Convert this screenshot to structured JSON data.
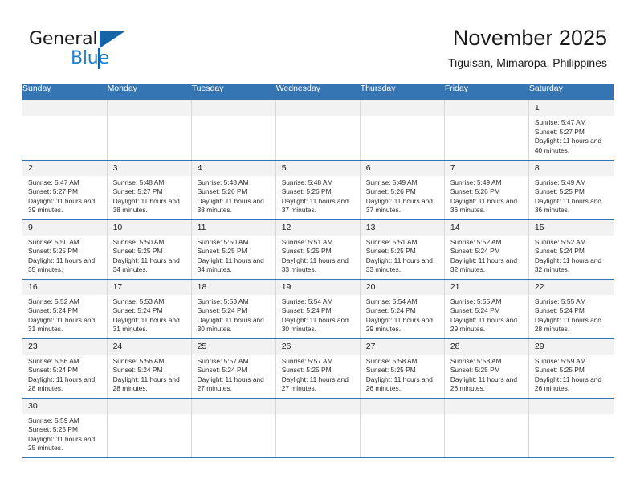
{
  "brand": {
    "name_part1": "General",
    "name_part2": "Blue"
  },
  "header": {
    "title": "November 2025",
    "subtitle": "Tiguisan, Mimaropa, Philippines"
  },
  "colors": {
    "header_blue": "#3575b4",
    "brand_blue": "#2280c8",
    "brand_dark_blue": "#1565a8",
    "daynum_bg": "#f2f2f2",
    "cell_border": "#d8d8d8"
  },
  "weekdays": [
    "Sunday",
    "Monday",
    "Tuesday",
    "Wednesday",
    "Thursday",
    "Friday",
    "Saturday"
  ],
  "weeks": [
    [
      {
        "day": "",
        "empty": true,
        "sunrise": "",
        "sunset": "",
        "daylight": ""
      },
      {
        "day": "",
        "empty": true,
        "sunrise": "",
        "sunset": "",
        "daylight": ""
      },
      {
        "day": "",
        "empty": true,
        "sunrise": "",
        "sunset": "",
        "daylight": ""
      },
      {
        "day": "",
        "empty": true,
        "sunrise": "",
        "sunset": "",
        "daylight": ""
      },
      {
        "day": "",
        "empty": true,
        "sunrise": "",
        "sunset": "",
        "daylight": ""
      },
      {
        "day": "",
        "empty": true,
        "sunrise": "",
        "sunset": "",
        "daylight": ""
      },
      {
        "day": "1",
        "empty": false,
        "sunrise": "Sunrise: 5:47 AM",
        "sunset": "Sunset: 5:27 PM",
        "daylight": "Daylight: 11 hours and 40 minutes."
      }
    ],
    [
      {
        "day": "2",
        "empty": false,
        "sunrise": "Sunrise: 5:47 AM",
        "sunset": "Sunset: 5:27 PM",
        "daylight": "Daylight: 11 hours and 39 minutes."
      },
      {
        "day": "3",
        "empty": false,
        "sunrise": "Sunrise: 5:48 AM",
        "sunset": "Sunset: 5:27 PM",
        "daylight": "Daylight: 11 hours and 38 minutes."
      },
      {
        "day": "4",
        "empty": false,
        "sunrise": "Sunrise: 5:48 AM",
        "sunset": "Sunset: 5:26 PM",
        "daylight": "Daylight: 11 hours and 38 minutes."
      },
      {
        "day": "5",
        "empty": false,
        "sunrise": "Sunrise: 5:48 AM",
        "sunset": "Sunset: 5:26 PM",
        "daylight": "Daylight: 11 hours and 37 minutes."
      },
      {
        "day": "6",
        "empty": false,
        "sunrise": "Sunrise: 5:49 AM",
        "sunset": "Sunset: 5:26 PM",
        "daylight": "Daylight: 11 hours and 37 minutes."
      },
      {
        "day": "7",
        "empty": false,
        "sunrise": "Sunrise: 5:49 AM",
        "sunset": "Sunset: 5:26 PM",
        "daylight": "Daylight: 11 hours and 36 minutes."
      },
      {
        "day": "8",
        "empty": false,
        "sunrise": "Sunrise: 5:49 AM",
        "sunset": "Sunset: 5:25 PM",
        "daylight": "Daylight: 11 hours and 36 minutes."
      }
    ],
    [
      {
        "day": "9",
        "empty": false,
        "sunrise": "Sunrise: 5:50 AM",
        "sunset": "Sunset: 5:25 PM",
        "daylight": "Daylight: 11 hours and 35 minutes."
      },
      {
        "day": "10",
        "empty": false,
        "sunrise": "Sunrise: 5:50 AM",
        "sunset": "Sunset: 5:25 PM",
        "daylight": "Daylight: 11 hours and 34 minutes."
      },
      {
        "day": "11",
        "empty": false,
        "sunrise": "Sunrise: 5:50 AM",
        "sunset": "Sunset: 5:25 PM",
        "daylight": "Daylight: 11 hours and 34 minutes."
      },
      {
        "day": "12",
        "empty": false,
        "sunrise": "Sunrise: 5:51 AM",
        "sunset": "Sunset: 5:25 PM",
        "daylight": "Daylight: 11 hours and 33 minutes."
      },
      {
        "day": "13",
        "empty": false,
        "sunrise": "Sunrise: 5:51 AM",
        "sunset": "Sunset: 5:25 PM",
        "daylight": "Daylight: 11 hours and 33 minutes."
      },
      {
        "day": "14",
        "empty": false,
        "sunrise": "Sunrise: 5:52 AM",
        "sunset": "Sunset: 5:24 PM",
        "daylight": "Daylight: 11 hours and 32 minutes."
      },
      {
        "day": "15",
        "empty": false,
        "sunrise": "Sunrise: 5:52 AM",
        "sunset": "Sunset: 5:24 PM",
        "daylight": "Daylight: 11 hours and 32 minutes."
      }
    ],
    [
      {
        "day": "16",
        "empty": false,
        "sunrise": "Sunrise: 5:52 AM",
        "sunset": "Sunset: 5:24 PM",
        "daylight": "Daylight: 11 hours and 31 minutes."
      },
      {
        "day": "17",
        "empty": false,
        "sunrise": "Sunrise: 5:53 AM",
        "sunset": "Sunset: 5:24 PM",
        "daylight": "Daylight: 11 hours and 31 minutes."
      },
      {
        "day": "18",
        "empty": false,
        "sunrise": "Sunrise: 5:53 AM",
        "sunset": "Sunset: 5:24 PM",
        "daylight": "Daylight: 11 hours and 30 minutes."
      },
      {
        "day": "19",
        "empty": false,
        "sunrise": "Sunrise: 5:54 AM",
        "sunset": "Sunset: 5:24 PM",
        "daylight": "Daylight: 11 hours and 30 minutes."
      },
      {
        "day": "20",
        "empty": false,
        "sunrise": "Sunrise: 5:54 AM",
        "sunset": "Sunset: 5:24 PM",
        "daylight": "Daylight: 11 hours and 29 minutes."
      },
      {
        "day": "21",
        "empty": false,
        "sunrise": "Sunrise: 5:55 AM",
        "sunset": "Sunset: 5:24 PM",
        "daylight": "Daylight: 11 hours and 29 minutes."
      },
      {
        "day": "22",
        "empty": false,
        "sunrise": "Sunrise: 5:55 AM",
        "sunset": "Sunset: 5:24 PM",
        "daylight": "Daylight: 11 hours and 28 minutes."
      }
    ],
    [
      {
        "day": "23",
        "empty": false,
        "sunrise": "Sunrise: 5:56 AM",
        "sunset": "Sunset: 5:24 PM",
        "daylight": "Daylight: 11 hours and 28 minutes."
      },
      {
        "day": "24",
        "empty": false,
        "sunrise": "Sunrise: 5:56 AM",
        "sunset": "Sunset: 5:24 PM",
        "daylight": "Daylight: 11 hours and 28 minutes."
      },
      {
        "day": "25",
        "empty": false,
        "sunrise": "Sunrise: 5:57 AM",
        "sunset": "Sunset: 5:24 PM",
        "daylight": "Daylight: 11 hours and 27 minutes."
      },
      {
        "day": "26",
        "empty": false,
        "sunrise": "Sunrise: 5:57 AM",
        "sunset": "Sunset: 5:25 PM",
        "daylight": "Daylight: 11 hours and 27 minutes."
      },
      {
        "day": "27",
        "empty": false,
        "sunrise": "Sunrise: 5:58 AM",
        "sunset": "Sunset: 5:25 PM",
        "daylight": "Daylight: 11 hours and 26 minutes."
      },
      {
        "day": "28",
        "empty": false,
        "sunrise": "Sunrise: 5:58 AM",
        "sunset": "Sunset: 5:25 PM",
        "daylight": "Daylight: 11 hours and 26 minutes."
      },
      {
        "day": "29",
        "empty": false,
        "sunrise": "Sunrise: 5:59 AM",
        "sunset": "Sunset: 5:25 PM",
        "daylight": "Daylight: 11 hours and 26 minutes."
      }
    ],
    [
      {
        "day": "30",
        "empty": false,
        "sunrise": "Sunrise: 5:59 AM",
        "sunset": "Sunset: 5:25 PM",
        "daylight": "Daylight: 11 hours and 25 minutes."
      },
      {
        "day": "",
        "empty": true,
        "sunrise": "",
        "sunset": "",
        "daylight": ""
      },
      {
        "day": "",
        "empty": true,
        "sunrise": "",
        "sunset": "",
        "daylight": ""
      },
      {
        "day": "",
        "empty": true,
        "sunrise": "",
        "sunset": "",
        "daylight": ""
      },
      {
        "day": "",
        "empty": true,
        "sunrise": "",
        "sunset": "",
        "daylight": ""
      },
      {
        "day": "",
        "empty": true,
        "sunrise": "",
        "sunset": "",
        "daylight": ""
      },
      {
        "day": "",
        "empty": true,
        "sunrise": "",
        "sunset": "",
        "daylight": ""
      }
    ]
  ]
}
